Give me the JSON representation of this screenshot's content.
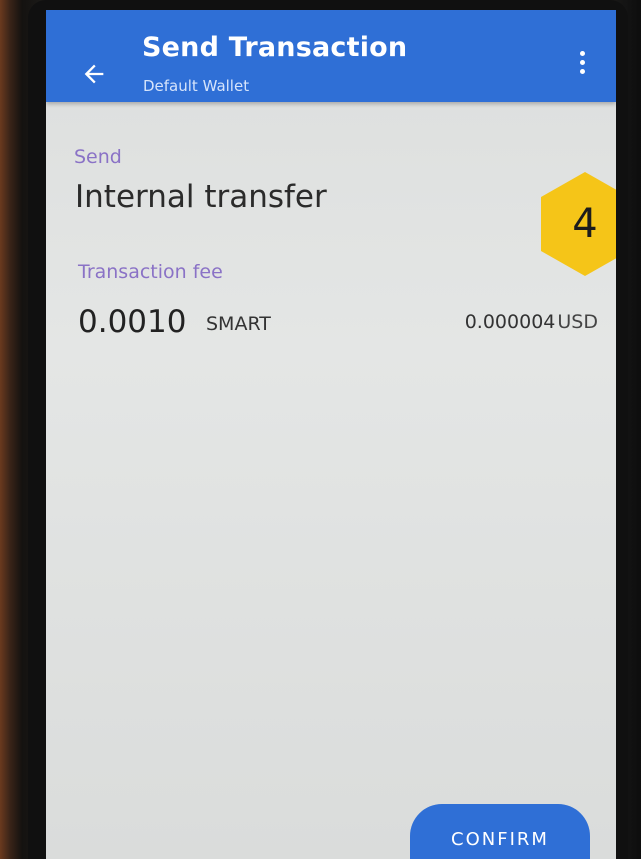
{
  "app_bar": {
    "title": "Send Transaction",
    "subtitle": "Default Wallet",
    "back_icon": "arrow-left-icon",
    "menu_icon": "more-vertical-icon",
    "color": "#2f6fd6"
  },
  "send": {
    "label": "Send",
    "value": "Internal transfer"
  },
  "fee": {
    "label": "Transaction fee",
    "amount": "0.0010",
    "unit": "SMART",
    "fiat_amount": "0.000004",
    "fiat_unit": "USD"
  },
  "step_badge": {
    "number": "4",
    "color": "#f5c518"
  },
  "confirm": {
    "label": "CONFIRM"
  },
  "colors": {
    "label_purple": "#8a72c6",
    "screen_bg": "#e0e2e1"
  }
}
